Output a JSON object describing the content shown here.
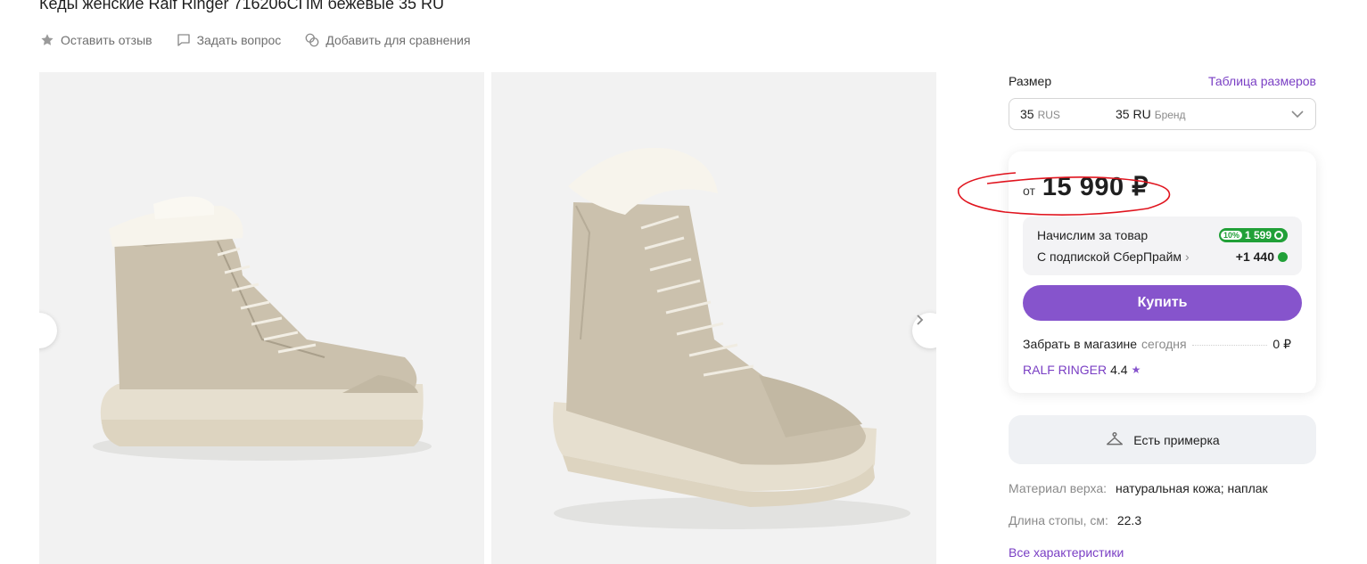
{
  "product": {
    "title": "Кеды женские Ralf Ringer 716206СПМ бежевые 35 RU"
  },
  "actions": [
    {
      "label": "Оставить отзыв",
      "icon": "star-icon"
    },
    {
      "label": "Задать вопрос",
      "icon": "chat-icon"
    },
    {
      "label": "Добавить для сравнения",
      "icon": "compare-icon"
    }
  ],
  "gallery": {
    "prev_icon": "chevron-left-icon",
    "next_icon": "chevron-right-icon"
  },
  "size": {
    "label": "Размер",
    "table_link": "Таблица размеров",
    "rus_value": "35",
    "rus_unit": "RUS",
    "brand_value": "35 RU",
    "brand_unit": "Бренд"
  },
  "offer": {
    "from": "от",
    "price": "15 990 ₽",
    "bonus_label": "Начислим за товар",
    "bonus_percent": "10%",
    "bonus_value": "1 599",
    "prime_label": "С подпиской СберПрайм",
    "prime_arrow": "›",
    "prime_value": "+1 440",
    "buy_label": "Купить",
    "pickup_label": "Забрать в магазине",
    "pickup_when": "сегодня",
    "pickup_cost": "0 ₽",
    "seller_name": "RALF RINGER",
    "seller_rating": "4.4",
    "seller_star": "★"
  },
  "tryon": {
    "label": "Есть примерка"
  },
  "specs": [
    {
      "key": "Материал верха:",
      "value": "натуральная кожа; наплак"
    },
    {
      "key": "Длина стопы, см:",
      "value": "22.3"
    }
  ],
  "all_specs": "Все характеристики",
  "colors": {
    "accent": "#8654cc",
    "link": "#7a3fc4",
    "bonus_green": "#21a038",
    "annotation_red": "#e0141e"
  }
}
